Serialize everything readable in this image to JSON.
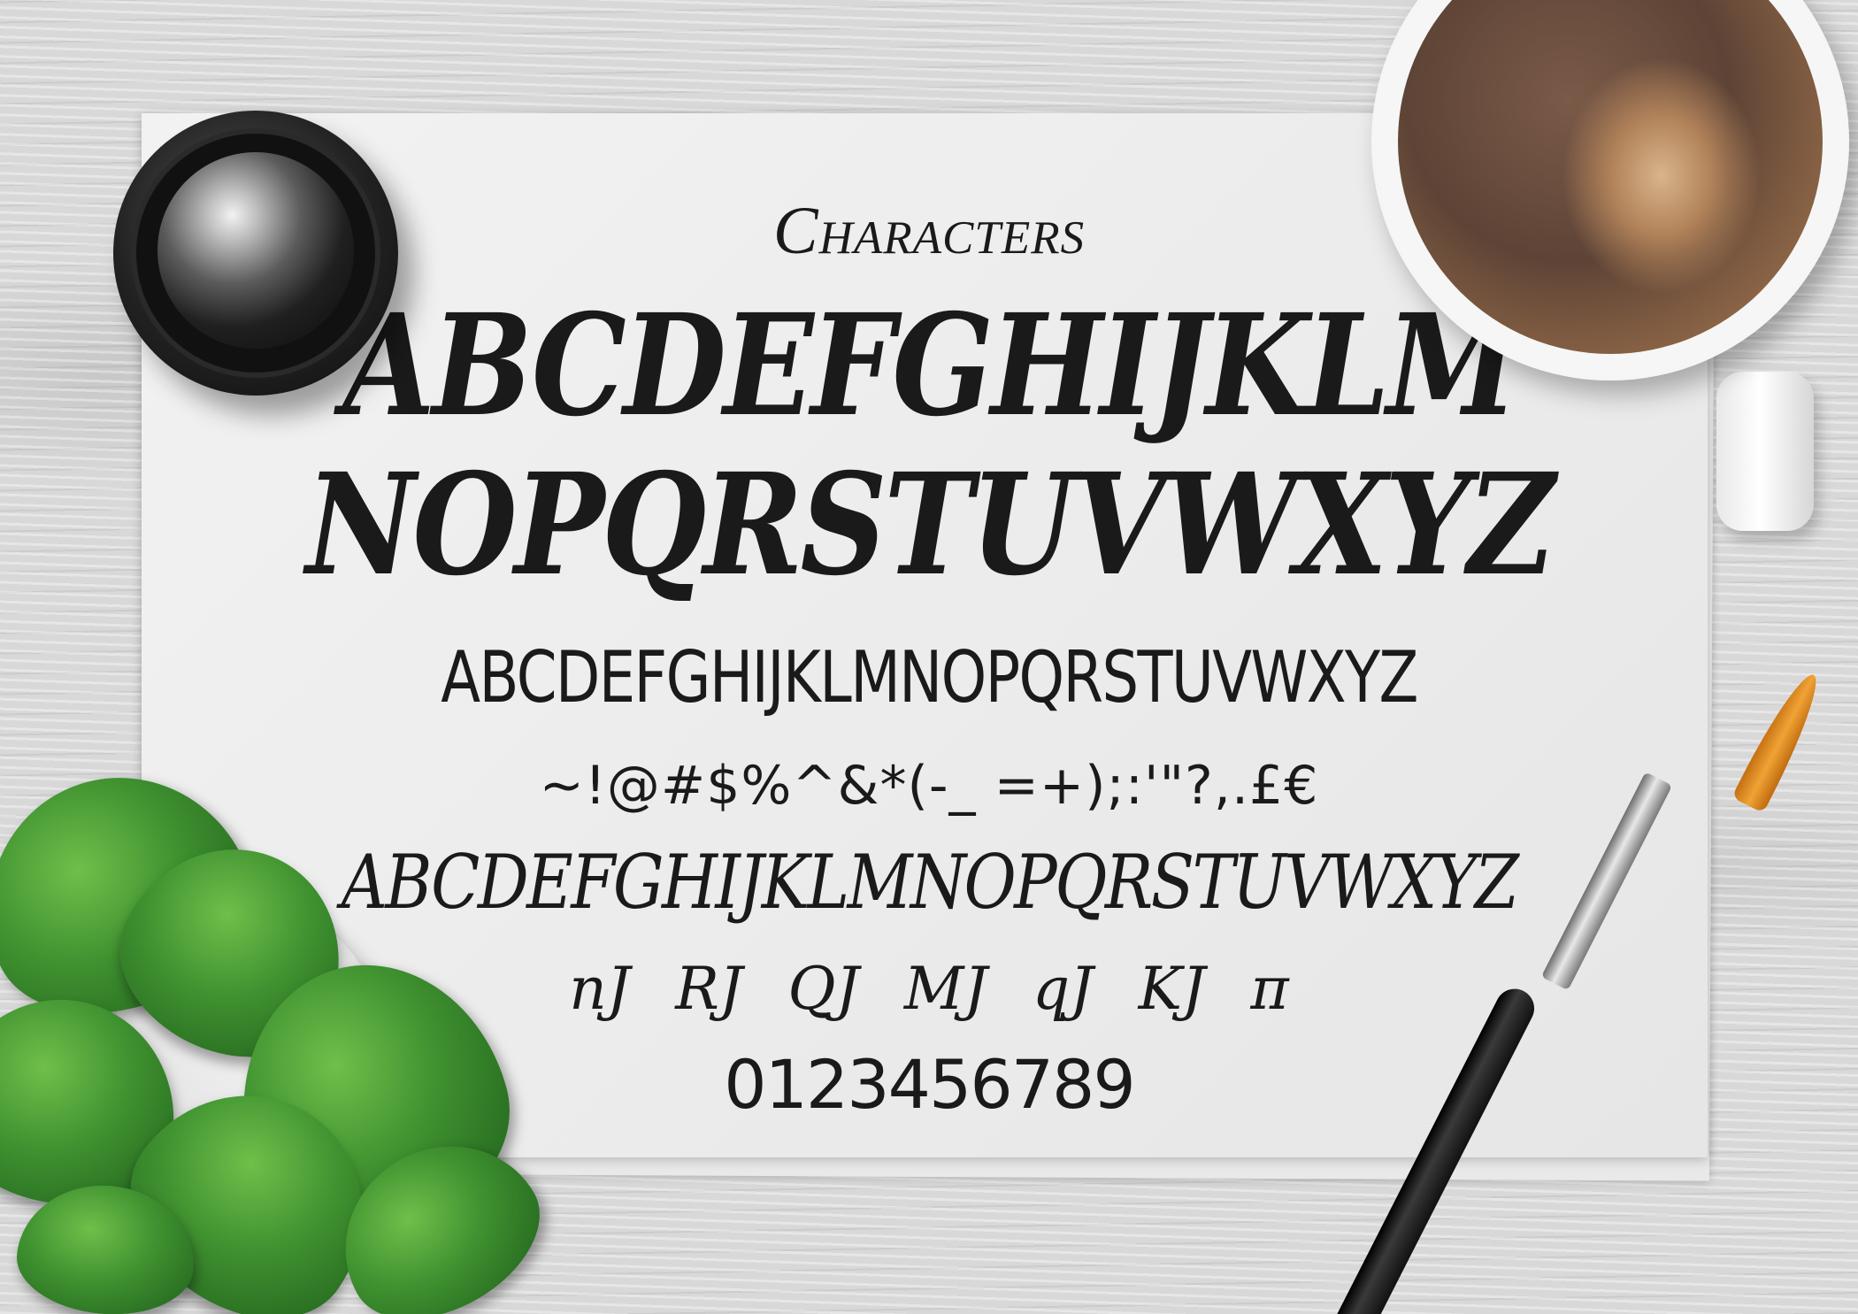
{
  "sheet": {
    "title": "Characters",
    "uppercase_line_1": "ABCDEFGHIJKLM",
    "uppercase_line_2": "NOPQRSTUVWXYZ",
    "caps_line": "ABCDEFGHIJKLMNOPQRSTUVWXYZ",
    "symbols_line": "~!@#$%^&*(-_ =+);:'\"?,.£€",
    "swash_line": "ABCDEFGHIJKLMNOPQRSTUVWXYZ",
    "ligatures_line": "nJ RJ QJ MJ qJ KJ π",
    "numbers_line": "0123456789"
  },
  "objects": {
    "ink_pot": "ink-pot",
    "coffee_cup": "coffee-cup",
    "plant": "plant",
    "paint_brush": "paint-brush"
  },
  "colors": {
    "ink": "#1a1a1a",
    "paper": "#ececec",
    "leaf": "#3f9130",
    "brush_tip": "#f0a335"
  }
}
